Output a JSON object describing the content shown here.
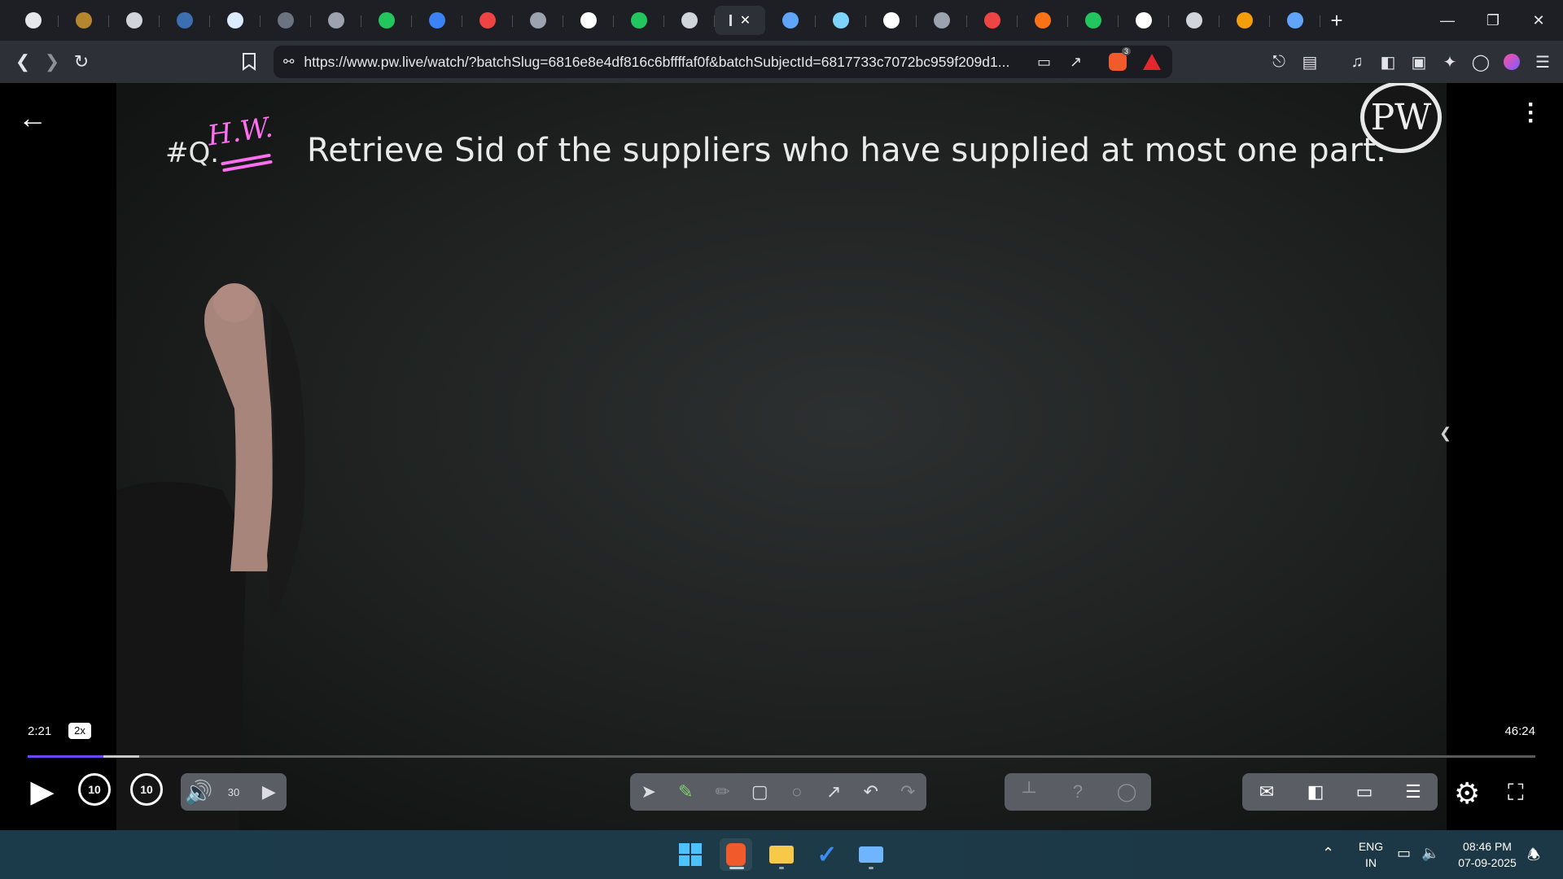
{
  "browser": {
    "tabs": [
      {
        "icon": "chatgpt-icon",
        "color": "#e5e7eb"
      },
      {
        "icon": "coin-icon",
        "color": "#b4872f"
      },
      {
        "icon": "globe-icon",
        "color": "#d1d5db"
      },
      {
        "icon": "sql-icon",
        "color": "#3b6fb0"
      },
      {
        "icon": "w3schools-icon",
        "color": "#dbeafe"
      },
      {
        "icon": "generic-icon",
        "color": "#6b7280"
      },
      {
        "icon": "profile-icon",
        "color": "#9ca3af"
      },
      {
        "icon": "whatsapp-icon",
        "color": "#22c55e"
      },
      {
        "icon": "bookmark-blue-icon",
        "color": "#3b82f6"
      },
      {
        "icon": "youtube-icon",
        "color": "#ef4444"
      },
      {
        "icon": "generic-icon",
        "color": "#9ca3af"
      },
      {
        "icon": "google-icon",
        "color": "#ffffff"
      },
      {
        "icon": "spotify-icon",
        "color": "#22c55e"
      },
      {
        "icon": "globe-icon",
        "color": "#d1d5db"
      },
      {
        "icon": "active-tab-icon",
        "color": "#d6d8de",
        "active": true
      },
      {
        "icon": "gemini-icon",
        "color": "#60a5fa"
      },
      {
        "icon": "chatgpt-icon",
        "color": "#7dd3fc"
      },
      {
        "icon": "google-icon",
        "color": "#ffffff"
      },
      {
        "icon": "monitor-icon",
        "color": "#9ca3af"
      },
      {
        "icon": "youtube-icon",
        "color": "#ef4444"
      },
      {
        "icon": "burger-icon",
        "color": "#f97316"
      },
      {
        "icon": "chart-icon",
        "color": "#22c55e"
      },
      {
        "icon": "wikipedia-icon",
        "color": "#ffffff"
      },
      {
        "icon": "globe-icon",
        "color": "#d1d5db"
      },
      {
        "icon": "india-flag-icon",
        "color": "#f59e0b"
      },
      {
        "icon": "gemini-icon",
        "color": "#60a5fa"
      }
    ],
    "url": "https://www.pw.live/watch/?batchSlug=6816e8e4df816c6bffffaf0f&batchSubjectId=6817733c7072bc959f209d1...",
    "brave_badge": "3"
  },
  "lecture": {
    "question_label": "#Q.",
    "handwritten_note": "H.W.",
    "question_text": "Retrieve Sid of the suppliers who have supplied at most one part.",
    "logo_text": "PW"
  },
  "player": {
    "current_time": "2:21",
    "speed": "2x",
    "total_time": "46:24",
    "progress": {
      "played": 0.05,
      "buffered": 0.074
    },
    "skip_back": "10",
    "skip_forward": "10",
    "playback_rate_icon": "30",
    "accent_color": "#6f45ff"
  },
  "taskbar": {
    "lang_primary": "ENG",
    "lang_secondary": "IN",
    "time": "08:46 PM",
    "date": "07-09-2025"
  }
}
